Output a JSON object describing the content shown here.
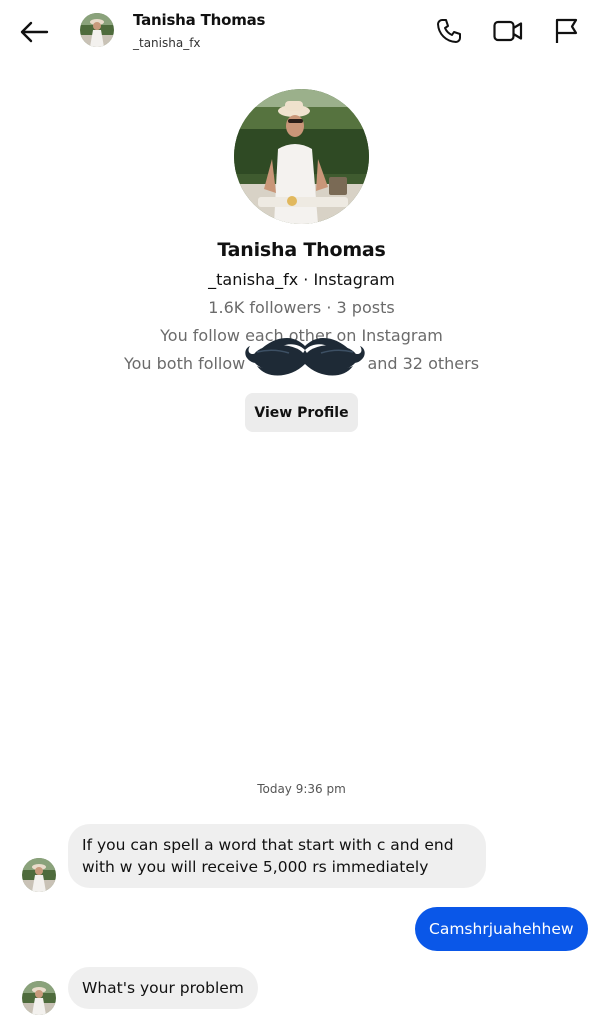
{
  "header": {
    "name": "Tanisha Thomas",
    "handle": "_tanisha_fx",
    "icons": [
      "back-arrow-icon",
      "phone-icon",
      "video-icon",
      "flag-icon"
    ]
  },
  "profile": {
    "name": "Tanisha Thomas",
    "handle_line": "_tanisha_fx · Instagram",
    "stats": "1.6K followers · 3 posts",
    "follow_status": "You follow each other on Instagram",
    "mutual": "You both follow",
    "mutual_rest": "and 32 others",
    "view_button": "View Profile"
  },
  "chat": {
    "timestamp": "Today 9:36 pm",
    "messages": [
      {
        "from": "them",
        "text": "If you can spell a word that start with c and end with w you will receive 5,000 rs immediately"
      },
      {
        "from": "me",
        "text": "Camshrjuahehhew"
      },
      {
        "from": "them",
        "text": "What's your problem"
      }
    ]
  },
  "colors": {
    "outgoing_bubble": "#0a57e8",
    "incoming_bubble": "#efefef",
    "secondary_text": "#6b6b6b"
  }
}
